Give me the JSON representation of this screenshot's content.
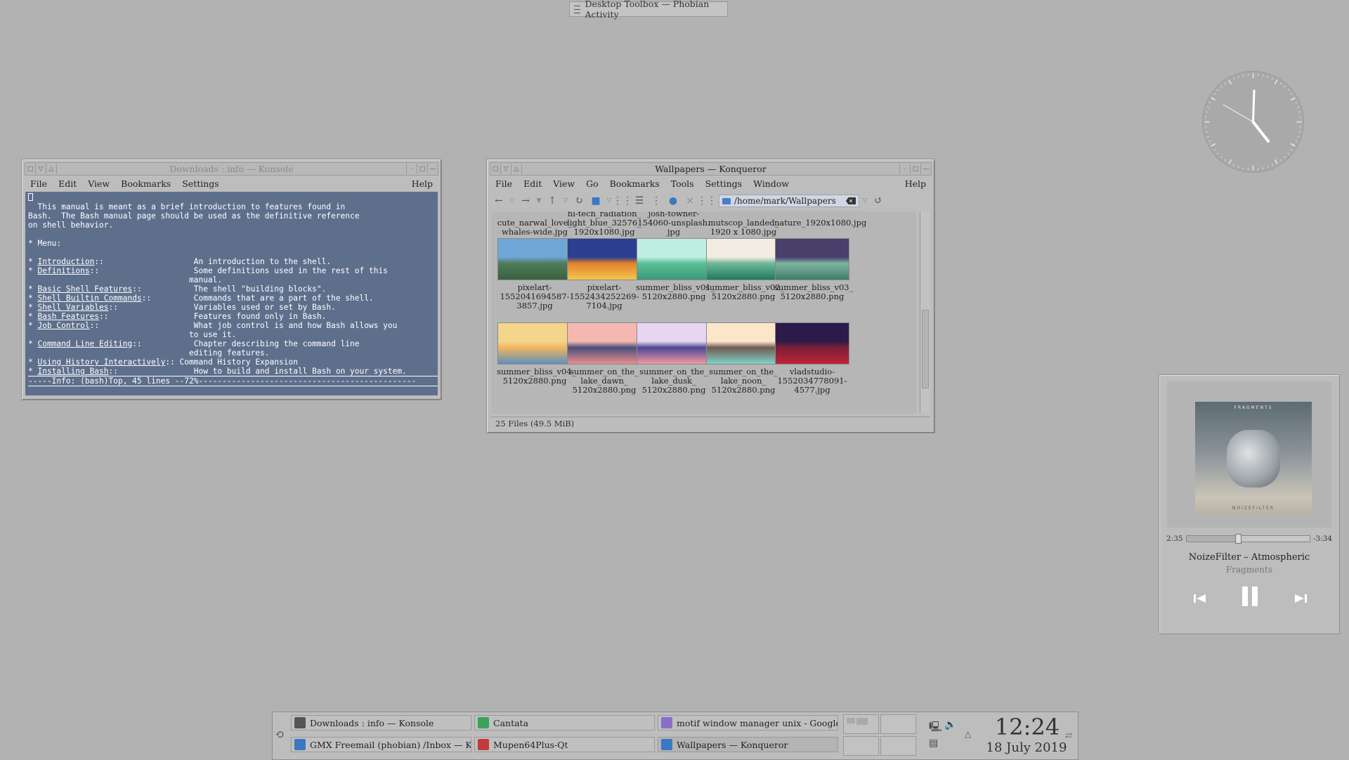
{
  "toolbox": {
    "label": "Desktop Toolbox — Phobian Activity"
  },
  "konsole": {
    "title": "Downloads : info — Konsole",
    "menu": [
      "File",
      "Edit",
      "View",
      "Bookmarks",
      "Settings"
    ],
    "help": "Help",
    "lines": [
      {
        "t": " "
      },
      {
        "t": "  This manual is meant as a brief introduction to features found in"
      },
      {
        "t": "Bash.  The Bash manual page should be used as the definitive reference"
      },
      {
        "t": "on shell behavior."
      },
      {
        "t": " "
      },
      {
        "t": "* Menu:"
      },
      {
        "t": " "
      },
      {
        "p": "* ",
        "l": "Introduction",
        "r": "::                   An introduction to the shell."
      },
      {
        "p": "* ",
        "l": "Definitions",
        "r": "::                    Some definitions used in the rest of this"
      },
      {
        "t": "                                  manual."
      },
      {
        "p": "* ",
        "l": "Basic Shell Features",
        "r": "::           The shell \"building blocks\"."
      },
      {
        "p": "* ",
        "l": "Shell Builtin Commands",
        "r": "::         Commands that are a part of the shell."
      },
      {
        "p": "* ",
        "l": "Shell Variables",
        "r": "::                Variables used or set by Bash."
      },
      {
        "p": "* ",
        "l": "Bash Features",
        "r": "::                  Features found only in Bash."
      },
      {
        "p": "* ",
        "l": "Job Control",
        "r": "::                    What job control is and how Bash allows you"
      },
      {
        "t": "                                  to use it."
      },
      {
        "p": "* ",
        "l": "Command Line Editing",
        "r": "::           Chapter describing the command line"
      },
      {
        "t": "                                  editing features."
      },
      {
        "p": "* ",
        "l": "Using History Interactively",
        "r": ":: Command History Expansion"
      },
      {
        "p": "* ",
        "l": "Installing Bash",
        "r": "::                How to build and install Bash on your system."
      }
    ],
    "modeline": "-----Info: (bash)Top, 45 lines --72%----------------------------------------------"
  },
  "konqueror": {
    "title": "Wallpapers — Konqueror",
    "menu": [
      "File",
      "Edit",
      "View",
      "Go",
      "Bookmarks",
      "Tools",
      "Settings",
      "Window"
    ],
    "help": "Help",
    "location": "/home/mark/Wallpapers",
    "partial_files": [
      [
        "cute_narwal_love_",
        "whales-wide.jpg"
      ],
      [
        "hi-tech_radiation_",
        "light_blue_32576_",
        "1920x1080.jpg"
      ],
      [
        "josh-towner-",
        "154060-unsplash.",
        "jpg"
      ],
      [
        "mutscop_landed_",
        "1920 x 1080.jpg"
      ],
      [
        "nature_1920x1080.jpg"
      ]
    ],
    "files": [
      {
        "name": [
          "pixelart-",
          "1552041694587-",
          "3857.jpg"
        ],
        "colors": [
          "#6fa6d8",
          "#4d7d5a",
          "#3b5f3f"
        ]
      },
      {
        "name": [
          "pixelart-",
          "1552434252269-",
          "7104.jpg"
        ],
        "colors": [
          "#2b3f8e",
          "#e2812f",
          "#f4c54e"
        ]
      },
      {
        "name": [
          "summer_bliss_v01_",
          "5120x2880.png"
        ],
        "colors": [
          "#bfeee3",
          "#5cbf98",
          "#3b9a7a"
        ]
      },
      {
        "name": [
          "summer_bliss_v02_",
          "5120x2880.png"
        ],
        "colors": [
          "#f3ece2",
          "#6fb79a",
          "#1f7a5a"
        ]
      },
      {
        "name": [
          "summer_bliss_v03_",
          "5120x2880.png"
        ],
        "colors": [
          "#4a3e6a",
          "#7fb3a0",
          "#3f7e6a"
        ]
      },
      {
        "name": [
          "summer_bliss_v04_",
          "5120x2880.png"
        ],
        "colors": [
          "#f3d58c",
          "#f0b65e",
          "#5f8fc0"
        ]
      },
      {
        "name": [
          "summer_on_the_",
          "lake_dawn_",
          "5120x2880.png"
        ],
        "colors": [
          "#f4b8b0",
          "#4a4f7a",
          "#e98e8e"
        ]
      },
      {
        "name": [
          "summer_on_the_",
          "lake_dusk_",
          "5120x2880.png"
        ],
        "colors": [
          "#e6d6ef",
          "#4d4797",
          "#f09aa0"
        ]
      },
      {
        "name": [
          "summer_on_the_",
          "lake_noon_",
          "5120x2880.png"
        ],
        "colors": [
          "#fbe6c9",
          "#6e5a52",
          "#7fd3c8"
        ]
      },
      {
        "name": [
          "vladstudio-",
          "1552034778091-",
          "4577.jpg"
        ],
        "colors": [
          "#2b1b4a",
          "#7a2035",
          "#c0233a"
        ]
      }
    ],
    "status": "25 Files (49.5 MiB)"
  },
  "player": {
    "elapsed": "2:35",
    "remaining": "-3:34",
    "progress": 0.42,
    "artist_title": "NoizeFilter – Atmospheric",
    "album": "Fragments",
    "cover_top": "FRAGMENTS",
    "cover_bottom": "NOIZEFILTER"
  },
  "taskbar": {
    "tasks": [
      {
        "label": "Downloads : info — Konsole",
        "icon_color": "#555"
      },
      {
        "label": "Cantata",
        "icon_color": "#3aa35a"
      },
      {
        "label": "motif window manager unix - Google S...",
        "icon_color": "#8a6fc7"
      },
      {
        "label": "GMX Freemail (phobian) /Inbox — KMail",
        "icon_color": "#3a78c2"
      },
      {
        "label": "Mupen64Plus-Qt",
        "icon_color": "#c23a3a"
      },
      {
        "label": "Wallpapers — Konqueror",
        "icon_color": "#3a78c2"
      }
    ],
    "time": "12:24",
    "date": "18 July 2019"
  }
}
